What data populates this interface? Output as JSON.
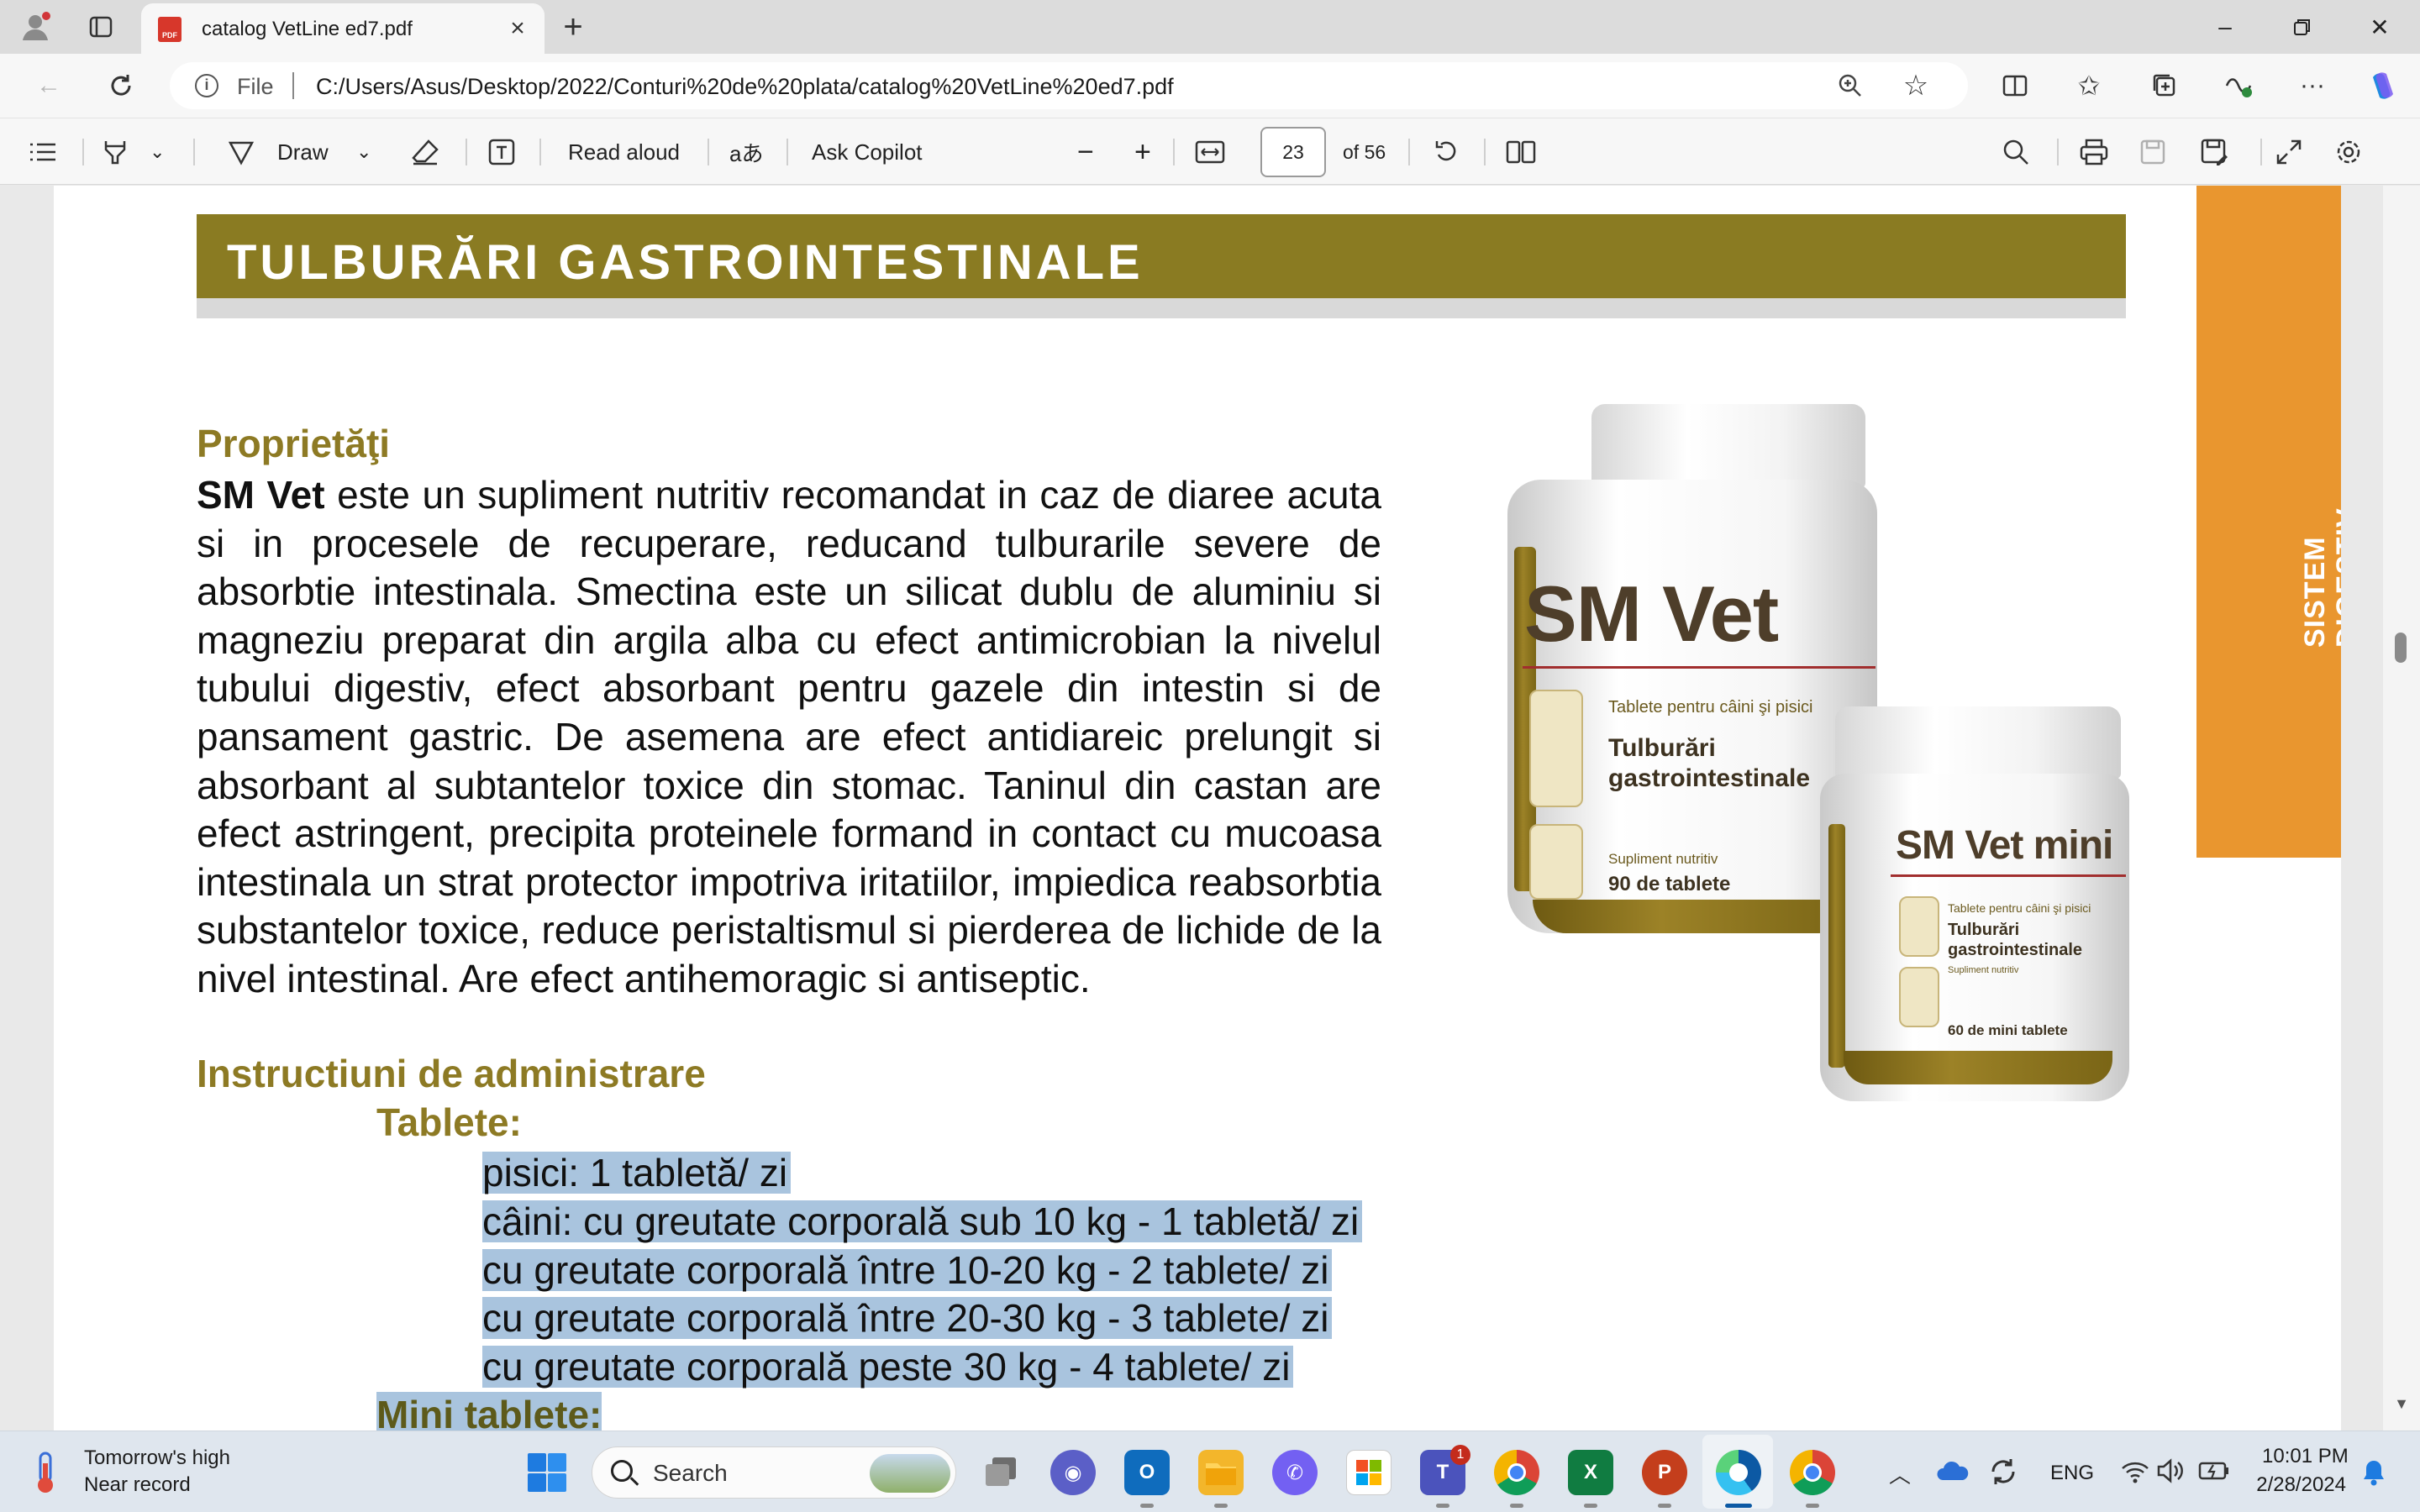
{
  "browser": {
    "tab_title": "catalog VetLine ed7.pdf",
    "tab_badge": "PDF",
    "file_label": "File",
    "url": "C:/Users/Asus/Desktop/2022/Conturi%20de%20plata/catalog%20VetLine%20ed7.pdf"
  },
  "pdf_toolbar": {
    "draw_label": "Draw",
    "read_aloud_label": "Read aloud",
    "translate_glyph": "aあ",
    "ask_copilot_label": "Ask Copilot",
    "current_page": "23",
    "total_pages": "of 56"
  },
  "page": {
    "banner_title": "TULBURĂRI GASTROINTESTINALE",
    "side_tab_line1": "SISTEM",
    "side_tab_line2": "DIGESTIV",
    "section1_heading": "Proprietăţi",
    "section1_lead_bold": "SM Vet",
    "section1_body": " este un supliment nutritiv recomandat in caz de diaree acuta si in procesele de recuperare, reducand tulburarile severe de absorbtie intestinala. Smectina este un silicat dublu de aluminiu si magneziu preparat din argila alba cu efect antimicrobian la nivelul tubului digestiv, efect absorbant pentru gazele din intestin si de pansament gastric. De asemena are efect antidiareic prelungit si absorbant al subtantelor toxice din stomac. Taninul din castan are efect astringent, precipita proteinele formand in contact cu mucoasa intestinala un strat protector impotriva iritatiilor, impiedica reabsorbtia substantelor toxice, reduce peristaltismul si pierderea de lichide de la nivel intestinal. Are efect antihemoragic si antiseptic.",
    "section2_heading": "Instructiuni de administrare",
    "tablets_heading": "Tablete:",
    "dosage_lines": [
      "pisici: 1 tabletă/ zi",
      "câini: cu greutate corporală sub 10 kg - 1 tabletă/ zi",
      "cu greutate corporală între 10-20 kg - 2 tablete/ zi",
      "cu greutate corporală între 20-30 kg - 3 tablete/ zi",
      "cu greutate corporală peste 30 kg - 4 tablete/ zi"
    ],
    "mini_tablets_heading": "Mini tablete:",
    "product_large": {
      "name": "SM Vet",
      "subtitle": "Tablete pentru câini şi pisici",
      "purpose_line1": "Tulburări",
      "purpose_line2": "gastrointestinale",
      "supplement": "Supliment nutritiv",
      "count": "90 de tablete"
    },
    "product_small": {
      "name": "SM Vet mini",
      "subtitle": "Tablete pentru câini şi pisici",
      "purpose_line1": "Tulburări",
      "purpose_line2": "gastrointestinale",
      "supplement": "Supliment nutritiv",
      "count": "60 de mini tablete"
    }
  },
  "taskbar": {
    "weather_line1": "Tomorrow's high",
    "weather_line2": "Near record",
    "search_placeholder": "Search",
    "teams_badge": "1",
    "language": "ENG",
    "time": "10:01 PM",
    "date": "2/28/2024"
  },
  "colors": {
    "banner_olive": "#8a7b22",
    "heading_olive": "#8d7a24",
    "side_tab_orange": "#e9962f",
    "selection_blue": "#a9c4de"
  }
}
